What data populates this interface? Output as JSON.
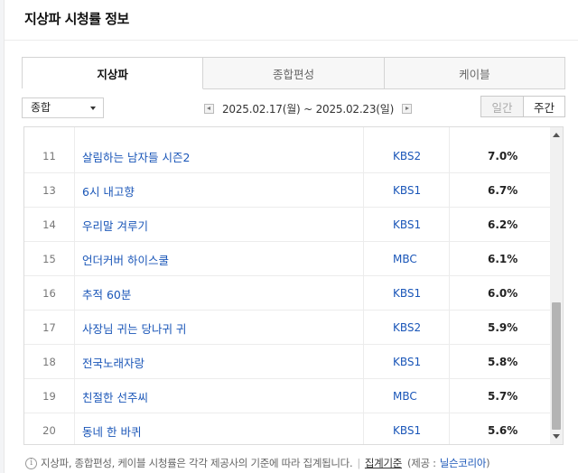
{
  "section_title": "지상파 시청률 정보",
  "tabs": [
    {
      "label": "지상파",
      "active": true
    },
    {
      "label": "종합편성",
      "active": false
    },
    {
      "label": "케이블",
      "active": false
    }
  ],
  "filter": {
    "selected": "종합"
  },
  "period": {
    "text": "2025.02.17(월) ~ 2025.02.23(일)"
  },
  "toggle": {
    "daily": "일간",
    "weekly": "주간",
    "selected": "주간"
  },
  "rows": [
    {
      "rank": "11",
      "program": "살림하는 남자들 시즌2",
      "channel": "KBS2",
      "rating": "7.0%"
    },
    {
      "rank": "13",
      "program": "6시 내고향",
      "channel": "KBS1",
      "rating": "6.7%"
    },
    {
      "rank": "14",
      "program": "우리말 겨루기",
      "channel": "KBS1",
      "rating": "6.2%"
    },
    {
      "rank": "15",
      "program": "언더커버 하이스쿨",
      "channel": "MBC",
      "rating": "6.1%"
    },
    {
      "rank": "16",
      "program": "추적 60분",
      "channel": "KBS1",
      "rating": "6.0%"
    },
    {
      "rank": "17",
      "program": "사장님 귀는 당나귀 귀",
      "channel": "KBS2",
      "rating": "5.9%"
    },
    {
      "rank": "18",
      "program": "전국노래자랑",
      "channel": "KBS1",
      "rating": "5.8%"
    },
    {
      "rank": "19",
      "program": "친절한 선주씨",
      "channel": "MBC",
      "rating": "5.7%"
    },
    {
      "rank": "20",
      "program": "동네 한 바퀴",
      "channel": "KBS1",
      "rating": "5.6%"
    }
  ],
  "footer": {
    "note": "지상파, 종합편성, 케이블 시청률은 각각 제공사의 기준에 따라 집계됩니다.",
    "criteria_link": "집계기준",
    "provider_prefix": "(제공 :",
    "provider_name": "닐슨코리아",
    "provider_suffix": ")"
  },
  "colors": {
    "link_blue": "#1a56b8",
    "scroll_thumb": "#b4b4b4"
  },
  "icons": [
    "info-icon",
    "chevron-left-icon",
    "chevron-right-icon",
    "dropdown-arrow-icon",
    "scroll-up-icon",
    "scroll-down-icon"
  ]
}
